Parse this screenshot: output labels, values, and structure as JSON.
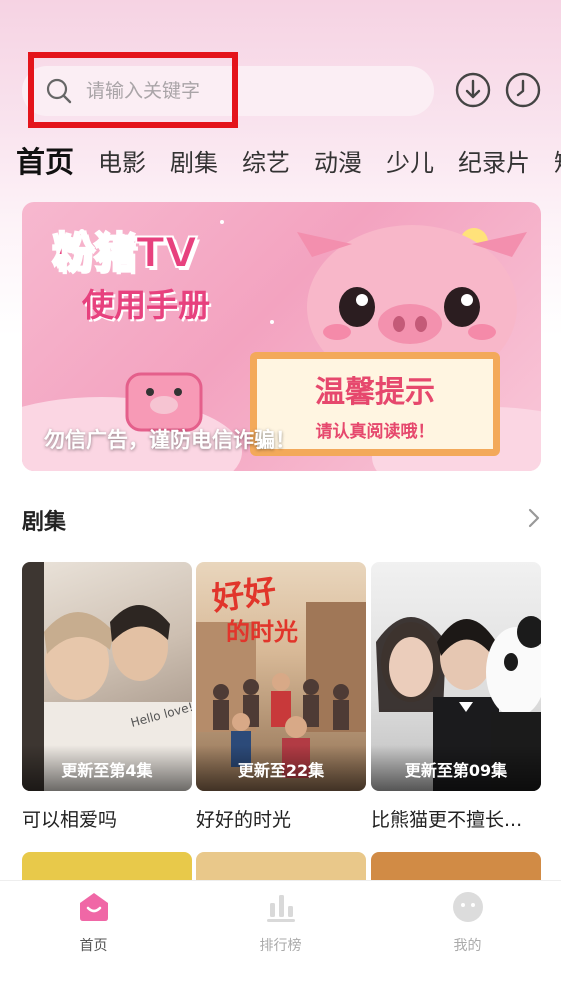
{
  "search": {
    "placeholder": "请输入关键字"
  },
  "header_icons": {
    "download": "download-icon",
    "history": "clock-icon"
  },
  "tabs": [
    "首页",
    "电影",
    "剧集",
    "综艺",
    "动漫",
    "少儿",
    "纪录片",
    "短"
  ],
  "banner": {
    "title": "粉猪TV",
    "subtitle": "使用手册",
    "sign_title": "温馨提示",
    "sign_sub": "请认真阅读哦！",
    "caption": "勿信广告，谨防电信诈骗！"
  },
  "section": {
    "title": "剧集",
    "more_icon": "chevron-right-icon"
  },
  "cards": [
    {
      "badge": "更新至第4集",
      "title": "可以相爱吗"
    },
    {
      "badge": "更新至22集",
      "title": "好好的时光"
    },
    {
      "badge": "更新至第09集",
      "title": "比熊猫更不擅长..."
    }
  ],
  "bottom_nav": [
    {
      "label": "首页",
      "icon": "home-icon",
      "active": true
    },
    {
      "label": "排行榜",
      "icon": "ranking-icon",
      "active": false
    },
    {
      "label": "我的",
      "icon": "profile-icon",
      "active": false
    }
  ],
  "colors": {
    "accent": "#f067a6",
    "highlight": "#e4141b"
  }
}
